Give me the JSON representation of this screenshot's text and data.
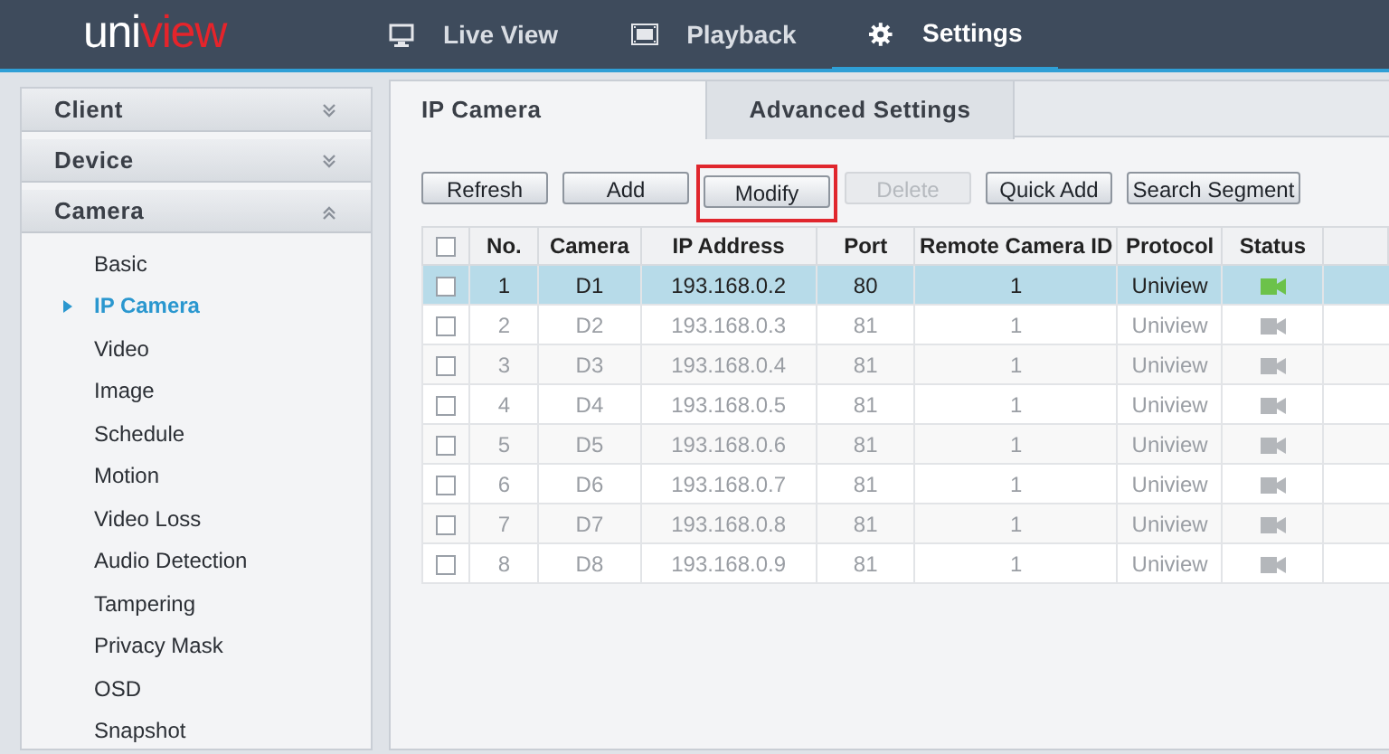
{
  "header": {
    "logo_left": "uni",
    "logo_right": "view",
    "nav": [
      {
        "label": "Live View",
        "selected": false
      },
      {
        "label": "Playback",
        "selected": false
      },
      {
        "label": "Settings",
        "selected": true
      }
    ]
  },
  "sidebar": {
    "sections": [
      {
        "label": "Client",
        "expanded": false
      },
      {
        "label": "Device",
        "expanded": false
      },
      {
        "label": "Camera",
        "expanded": true,
        "items": [
          {
            "label": "Basic",
            "selected": false
          },
          {
            "label": "IP Camera",
            "selected": true
          },
          {
            "label": "Video",
            "selected": false
          },
          {
            "label": "Image",
            "selected": false
          },
          {
            "label": "Schedule",
            "selected": false
          },
          {
            "label": "Motion",
            "selected": false
          },
          {
            "label": "Video Loss",
            "selected": false
          },
          {
            "label": "Audio Detection",
            "selected": false
          },
          {
            "label": "Tampering",
            "selected": false
          },
          {
            "label": "Privacy Mask",
            "selected": false
          },
          {
            "label": "OSD",
            "selected": false
          },
          {
            "label": "Snapshot",
            "selected": false
          }
        ]
      }
    ]
  },
  "tabs": [
    {
      "label": "IP Camera",
      "selected": true
    },
    {
      "label": "Advanced Settings",
      "selected": false
    }
  ],
  "toolbar": [
    {
      "label": "Refresh",
      "disabled": false,
      "highlighted": false
    },
    {
      "label": "Add",
      "disabled": false,
      "highlighted": false
    },
    {
      "label": "Modify",
      "disabled": false,
      "highlighted": true
    },
    {
      "label": "Delete",
      "disabled": true,
      "highlighted": false
    },
    {
      "label": "Quick Add",
      "disabled": false,
      "highlighted": false
    },
    {
      "label": "Search Segment",
      "disabled": false,
      "highlighted": false
    }
  ],
  "table": {
    "all_checked": false,
    "columns": [
      "No.",
      "Camera",
      "IP Address",
      "Port",
      "Remote Camera ID",
      "Protocol",
      "Status"
    ],
    "rows": [
      {
        "checked": false,
        "selected": true,
        "online": true,
        "cells": [
          "1",
          "D1",
          "193.168.0.2",
          "80",
          "1",
          "Uniview"
        ]
      },
      {
        "checked": false,
        "selected": false,
        "online": false,
        "cells": [
          "2",
          "D2",
          "193.168.0.3",
          "81",
          "1",
          "Uniview"
        ]
      },
      {
        "checked": false,
        "selected": false,
        "online": false,
        "cells": [
          "3",
          "D3",
          "193.168.0.4",
          "81",
          "1",
          "Uniview"
        ]
      },
      {
        "checked": false,
        "selected": false,
        "online": false,
        "cells": [
          "4",
          "D4",
          "193.168.0.5",
          "81",
          "1",
          "Uniview"
        ]
      },
      {
        "checked": false,
        "selected": false,
        "online": false,
        "cells": [
          "5",
          "D5",
          "193.168.0.6",
          "81",
          "1",
          "Uniview"
        ]
      },
      {
        "checked": false,
        "selected": false,
        "online": false,
        "cells": [
          "6",
          "D6",
          "193.168.0.7",
          "81",
          "1",
          "Uniview"
        ]
      },
      {
        "checked": false,
        "selected": false,
        "online": false,
        "cells": [
          "7",
          "D7",
          "193.168.0.8",
          "81",
          "1",
          "Uniview"
        ]
      },
      {
        "checked": false,
        "selected": false,
        "online": false,
        "cells": [
          "8",
          "D8",
          "193.168.0.9",
          "81",
          "1",
          "Uniview"
        ]
      }
    ]
  }
}
